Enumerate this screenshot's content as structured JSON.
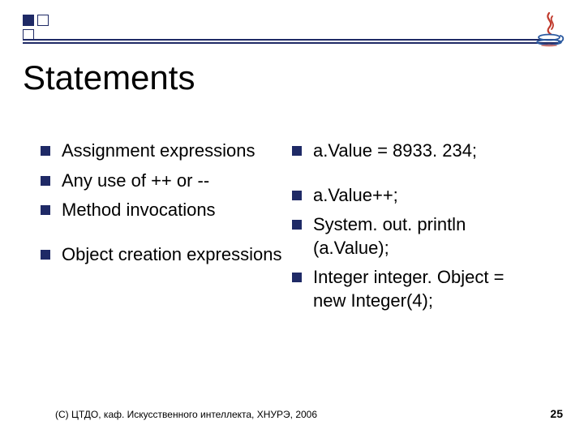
{
  "title": "Statements",
  "left_items": [
    "Assignment expressions",
    "Any use of ++ or --",
    "Method invocations",
    "Object creation expressions"
  ],
  "right_items": [
    "a.Value = 8933. 234;",
    "a.Value++;",
    "System. out. println (a.Value);",
    "Integer integer. Object = new Integer(4);"
  ],
  "left_gap_before": [
    false,
    false,
    false,
    true
  ],
  "right_gap_before": [
    false,
    true,
    false,
    false
  ],
  "footer": "(С) ЦТДО, каф. Искусственного интеллекта, ХНУРЭ, 2006",
  "page_number": "25",
  "logo_alt": "Java logo"
}
